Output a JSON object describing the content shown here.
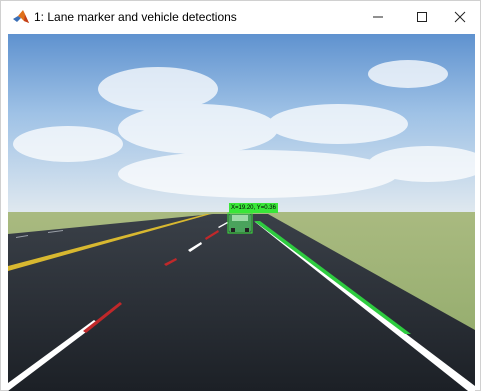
{
  "window": {
    "title": "1: Lane marker and vehicle detections",
    "app_icon": "matlab-icon",
    "controls": {
      "minimize": "minimize-icon",
      "maximize": "maximize-icon",
      "close": "close-icon"
    }
  },
  "scene": {
    "detection_label": "X=19.20, Y=0.36",
    "colors": {
      "detection_box": "#39e639",
      "lane_highlight": "#2ecc40",
      "left_yellow_line": "#d8b830",
      "dashed_marker": "#c0282a"
    }
  }
}
